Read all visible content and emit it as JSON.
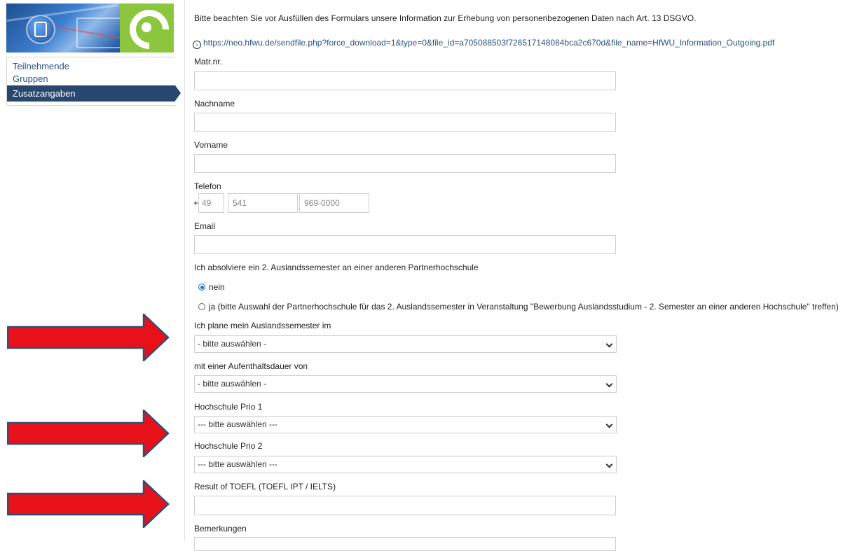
{
  "sidebar": {
    "items": [
      {
        "label": "Teilnehmende"
      },
      {
        "label": "Gruppen"
      },
      {
        "label": "Zusatzangaben"
      }
    ]
  },
  "form": {
    "notice": "Bitte beachten Sie vor Ausfüllen des Formulars unsere Information zur Erhebung von personenbezogenen Daten nach Art. 13 DSGVO.",
    "link": "https://neo.hfwu.de/sendfile.php?force_download=1&type=0&file_id=a705088503f726517148084bca2c670d&file_name=HfWU_Information_Outgoing.pdf",
    "matr_label": "Matr.nr.",
    "nachname_label": "Nachname",
    "vorname_label": "Vorname",
    "telefon_label": "Telefon",
    "telefon_plus": "+",
    "telefon_country_placeholder": "49",
    "telefon_area_placeholder": "541",
    "telefon_number_placeholder": "969-0000",
    "email_label": "Email",
    "semester2_label": "Ich absolviere ein 2. Auslandssemester an einer anderen Partnerhochschule",
    "radio_nein": "nein",
    "radio_ja": "ja (bitte Auswahl der Partnerhochschule für das 2. Auslandssemester in Veranstaltung \"Bewerbung Auslandsstudium - 2. Semester an einer anderen Hochschule\" treffen)",
    "plan_label": "Ich plane mein Auslandssemester im",
    "plan_value": "- bitte auswählen -",
    "dauer_label": "mit einer Aufenthaltsdauer von",
    "dauer_value": "- bitte auswählen -",
    "prio1_label": "Hochschule Prio 1",
    "prio1_value": "--- bitte auswählen ---",
    "prio2_label": "Hochschule Prio 2",
    "prio2_value": "--- bitte auswählen ---",
    "toefl_label": "Result of TOEFL (TOEFL IPT / IELTS)",
    "bemerkungen_label": "Bemerkungen"
  },
  "colors": {
    "arrow_fill": "#e8111a",
    "arrow_stroke": "#2f4f7a",
    "nav_active": "#27476e",
    "link": "#2b5380",
    "logo_green": "#8cc63f"
  }
}
